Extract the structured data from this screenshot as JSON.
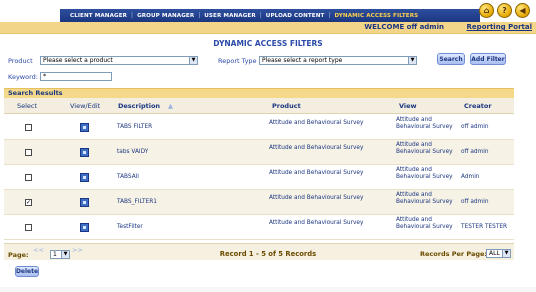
{
  "nav": {
    "items": [
      {
        "label": "CLIENT MANAGER",
        "active": false
      },
      {
        "label": "GROUP MANAGER",
        "active": false
      },
      {
        "label": "USER MANAGER",
        "active": false
      },
      {
        "label": "UPLOAD CONTENT",
        "active": false
      },
      {
        "label": "DYNAMIC ACCESS FILTERS",
        "active": true
      }
    ],
    "icons": [
      {
        "name": "home-icon",
        "glyph": "⌂"
      },
      {
        "name": "help-icon",
        "glyph": "?"
      },
      {
        "name": "back-icon",
        "glyph": "◀"
      }
    ]
  },
  "header": {
    "welcome": "WELCOME off admin",
    "portal_link": "Reporting Portal",
    "page_title": "DYNAMIC ACCESS FILTERS"
  },
  "filters": {
    "product_label": "Product",
    "product_value": "Please select a product",
    "report_type_label": "Report Type",
    "report_type_value": "Please select a report type",
    "keyword_label": "Keyword:",
    "keyword_value": "*",
    "search_button": "Search",
    "add_filter_button": "Add Filter"
  },
  "results": {
    "section_title": "Search Results",
    "columns": {
      "select": "Select",
      "view_edit": "View/Edit",
      "description": "Description",
      "product": "Product",
      "view": "View",
      "creator": "Creator"
    },
    "rows": [
      {
        "checked": false,
        "description": "TABS FILTER",
        "product": "Attitude and Behavioural Survey",
        "view": "Attitude and Behavioural Survey",
        "creator": "off admin"
      },
      {
        "checked": false,
        "description": "tabs VAIDY",
        "product": "Attitude and Behavioural Survey",
        "view": "Attitude and Behavioural Survey",
        "creator": "off admin"
      },
      {
        "checked": false,
        "description": "TABSAll",
        "product": "Attitude and Behavioural Survey",
        "view": "Attitude and Behavioural Survey",
        "creator": "Admin"
      },
      {
        "checked": true,
        "description": "TABS_FILTER1",
        "product": "Attitude and Behavioural Survey",
        "view": "Attitude and Behavioural Survey",
        "creator": "off admin"
      },
      {
        "checked": false,
        "description": "TestFilter",
        "product": "Attitude and Behavioural Survey",
        "view": "Attitude and Behavioural Survey",
        "creator": "TESTER TESTER"
      }
    ]
  },
  "pager": {
    "page_label": "Page:",
    "prev": "<<",
    "next": ">>",
    "current_page": "1",
    "record_text": "Record 1 - 5 of 5 Records",
    "records_per_page_label": "Records Per Page:",
    "records_per_page_value": "ALL"
  },
  "actions": {
    "delete_button": "Delete"
  }
}
